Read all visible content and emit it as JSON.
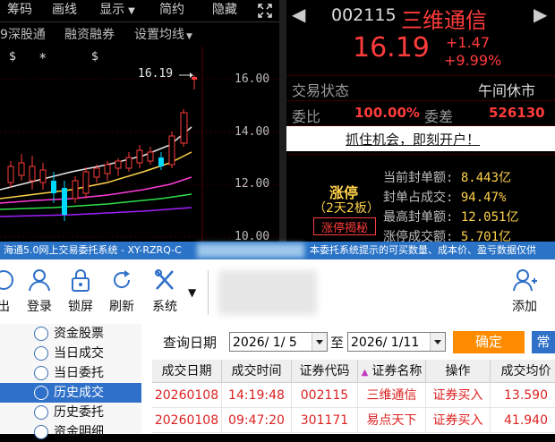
{
  "top_toolbar": {
    "items": [
      "筹码",
      "画线",
      "显示",
      "简约",
      "隐藏"
    ],
    "sub_items": [
      "9深股通",
      "融资融券",
      "设置均线"
    ],
    "fullscreen_icon": "expand-arrows-icon"
  },
  "chart": {
    "y_ticks": [
      "16.00",
      "14.00",
      "12.00",
      "10.00"
    ],
    "price_marker": "16.19",
    "markers": [
      "$",
      "*",
      "$"
    ]
  },
  "quote": {
    "code": "002115",
    "name": "三维通信",
    "price": "16.19",
    "change": "+1.47",
    "change_pct": "+9.99%",
    "status_label": "交易状态",
    "status_value": "午间休市",
    "weibi_label": "委比",
    "weibi_value": "100.00%",
    "weicha_label": "委差",
    "weicha_value": "526130",
    "promo_link": "抓住机会，即刻开户！",
    "limit_title": "涨停",
    "limit_sub": "（2天2板）",
    "limit_button": "涨停揭秘",
    "limit_stats": [
      {
        "label": "当前封单额:",
        "value": "8.443亿"
      },
      {
        "label": "封单占成交:",
        "value": "94.47%"
      },
      {
        "label": "最高封单额:",
        "value": "12.051亿"
      },
      {
        "label": "涨停成交额:",
        "value": "5.701亿"
      }
    ]
  },
  "window": {
    "title": "海通5.0网上交易委托系统 - XY-RZRQ-C",
    "notice": "本委托系统提示的可买数量、成本价、盈亏数据仅供",
    "toolbar": {
      "exit": "出",
      "login": "登录",
      "lock": "锁屏",
      "refresh": "刷新",
      "system": "系统",
      "add": "添加"
    },
    "nav": [
      "资金股票",
      "当日成交",
      "当日委托",
      "历史成交",
      "历史委托",
      "资金明细"
    ],
    "query": {
      "label": "查询日期",
      "start": "2026/ 1/ 5",
      "to": "至",
      "end": "2026/ 1/11",
      "confirm": "确定",
      "common": "常"
    },
    "table": {
      "headers": [
        "成交日期",
        "成交时间",
        "证券代码",
        "证券名称",
        "操作",
        "成交均价"
      ],
      "rows": [
        [
          "20260108",
          "14:19:48",
          "002115",
          "三维通信",
          "证券买入",
          "13.590"
        ],
        [
          "20260108",
          "09:47:20",
          "301171",
          "易点天下",
          "证券买入",
          "41.940"
        ]
      ]
    }
  },
  "colors": {
    "up": "#ff3b3b",
    "accent": "#2f70c9",
    "confirm": "#ff8c00",
    "limit": "#ffd24a"
  }
}
